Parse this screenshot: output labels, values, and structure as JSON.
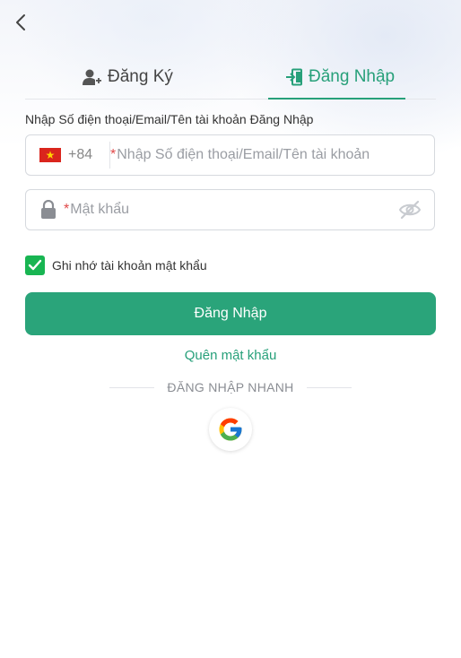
{
  "tabs": {
    "register": "Đăng Ký",
    "login": "Đăng Nhập"
  },
  "form": {
    "account_label": "Nhập Số điện thoại/Email/Tên tài khoản Đăng Nhập",
    "country_code": "+84",
    "country_flag": "vietnam-flag",
    "required_mark": "*",
    "account_placeholder": "Nhập Số điện thoại/Email/Tên tài khoản",
    "password_placeholder": "Mật khẩu",
    "remember_label": "Ghi nhớ tài khoản mật khẩu",
    "remember_checked": true,
    "login_button": "Đăng Nhập",
    "forgot_link": "Quên mật khẩu"
  },
  "quick_login": {
    "label": "ĐĂNG NHẬP NHANH",
    "providers": [
      "google-icon"
    ]
  },
  "colors": {
    "accent": "#27a07a",
    "button": "#2aa47a",
    "checkbox": "#18b552",
    "required": "#e04848"
  }
}
